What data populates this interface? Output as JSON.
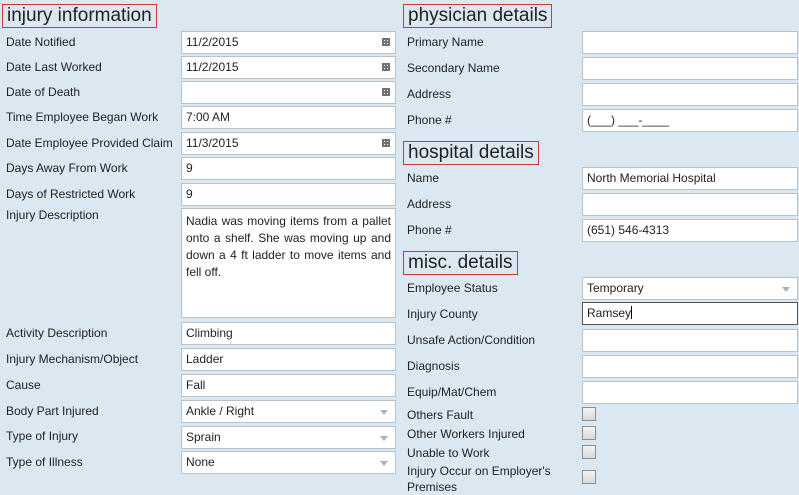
{
  "injury": {
    "title": "injury information",
    "date_notified": {
      "label": "Date Notified",
      "value": "11/2/2015",
      "icon": "calendar-icon"
    },
    "date_last_worked": {
      "label": "Date Last Worked",
      "value": "11/2/2015",
      "icon": "calendar-icon"
    },
    "date_of_death": {
      "label": "Date of Death",
      "value": "",
      "icon": "calendar-icon"
    },
    "time_began_work": {
      "label": "Time Employee Began Work",
      "value": "7:00 AM"
    },
    "date_provided_claim": {
      "label": "Date Employee Provided Claim",
      "value": "11/3/2015",
      "icon": "calendar-icon"
    },
    "days_away": {
      "label": "Days Away From Work",
      "value": "9"
    },
    "days_restricted": {
      "label": "Days of Restricted Work",
      "value": "9"
    },
    "description": {
      "label": "Injury Description",
      "value": "Nadia was moving items from a pallet onto a shelf. She was moving up and down a 4 ft ladder to move items and fell off."
    },
    "activity": {
      "label": "Activity Description",
      "value": "Climbing"
    },
    "mechanism": {
      "label": "Injury Mechanism/Object",
      "value": "Ladder"
    },
    "cause": {
      "label": "Cause",
      "value": "Fall"
    },
    "body_part": {
      "label": "Body Part Injured",
      "value": "Ankle / Right"
    },
    "type_injury": {
      "label": "Type of Injury",
      "value": "Sprain"
    },
    "type_illness": {
      "label": "Type of Illness",
      "value": "None"
    }
  },
  "physician": {
    "title": "physician details",
    "primary_name": {
      "label": "Primary Name",
      "value": ""
    },
    "secondary_name": {
      "label": "Secondary Name",
      "value": ""
    },
    "address": {
      "label": "Address",
      "value": ""
    },
    "phone": {
      "label": "Phone #",
      "value": "(___) ___-____"
    }
  },
  "hospital": {
    "title": "hospital details",
    "name": {
      "label": "Name",
      "value": "North Memorial Hospital"
    },
    "address": {
      "label": "Address",
      "value": ""
    },
    "phone": {
      "label": "Phone #",
      "value": "(651) 546-4313"
    }
  },
  "misc": {
    "title": "misc. details",
    "employee_status": {
      "label": "Employee Status",
      "value": "Temporary"
    },
    "injury_county": {
      "label": "Injury County",
      "value": "Ramsey"
    },
    "unsafe_action": {
      "label": "Unsafe Action/Condition",
      "value": ""
    },
    "diagnosis": {
      "label": "Diagnosis",
      "value": ""
    },
    "equip": {
      "label": "Equip/Mat/Chem",
      "value": ""
    },
    "others_fault": {
      "label": "Others Fault",
      "checked": false
    },
    "other_workers": {
      "label": "Other Workers Injured",
      "checked": false
    },
    "unable_to_work": {
      "label": "Unable to Work",
      "checked": false
    },
    "employer_premises": {
      "label": "Injury Occur on Employer's Premises",
      "checked": false
    }
  }
}
